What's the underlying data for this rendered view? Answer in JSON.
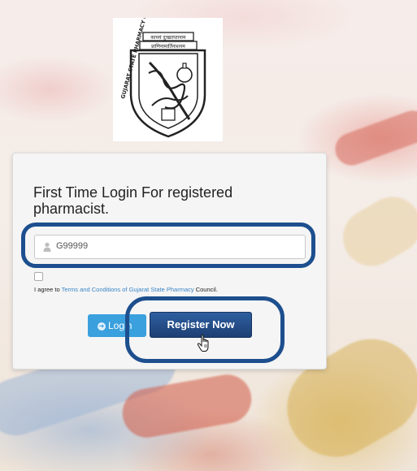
{
  "logo": {
    "top_text_1": "कामयं दुःखतप्तानाम",
    "top_text_2": "प्राणिनामार्तिनाशनम",
    "ring_text": "GUJARAT STATE PHARMACY COUNCIL"
  },
  "login_card": {
    "title": "First Time Login For registered pharmacist.",
    "username": {
      "value": "G99999",
      "placeholder": ""
    },
    "agree": {
      "prefix": "I agree to ",
      "link": "Terms and Conditions of Gujarat State Pharmacy",
      "suffix": " Council."
    },
    "login_button": "Login",
    "register_button": "Register Now"
  },
  "icons": {
    "user": "user-icon",
    "login_arrow": "arrow-circle-icon",
    "cursor": "hand-pointer-icon"
  },
  "colors": {
    "annotation_outline": "#1d4f8e",
    "register_button": "#1d3f74",
    "login_button": "#3aa0de",
    "link": "#3a85c6"
  }
}
